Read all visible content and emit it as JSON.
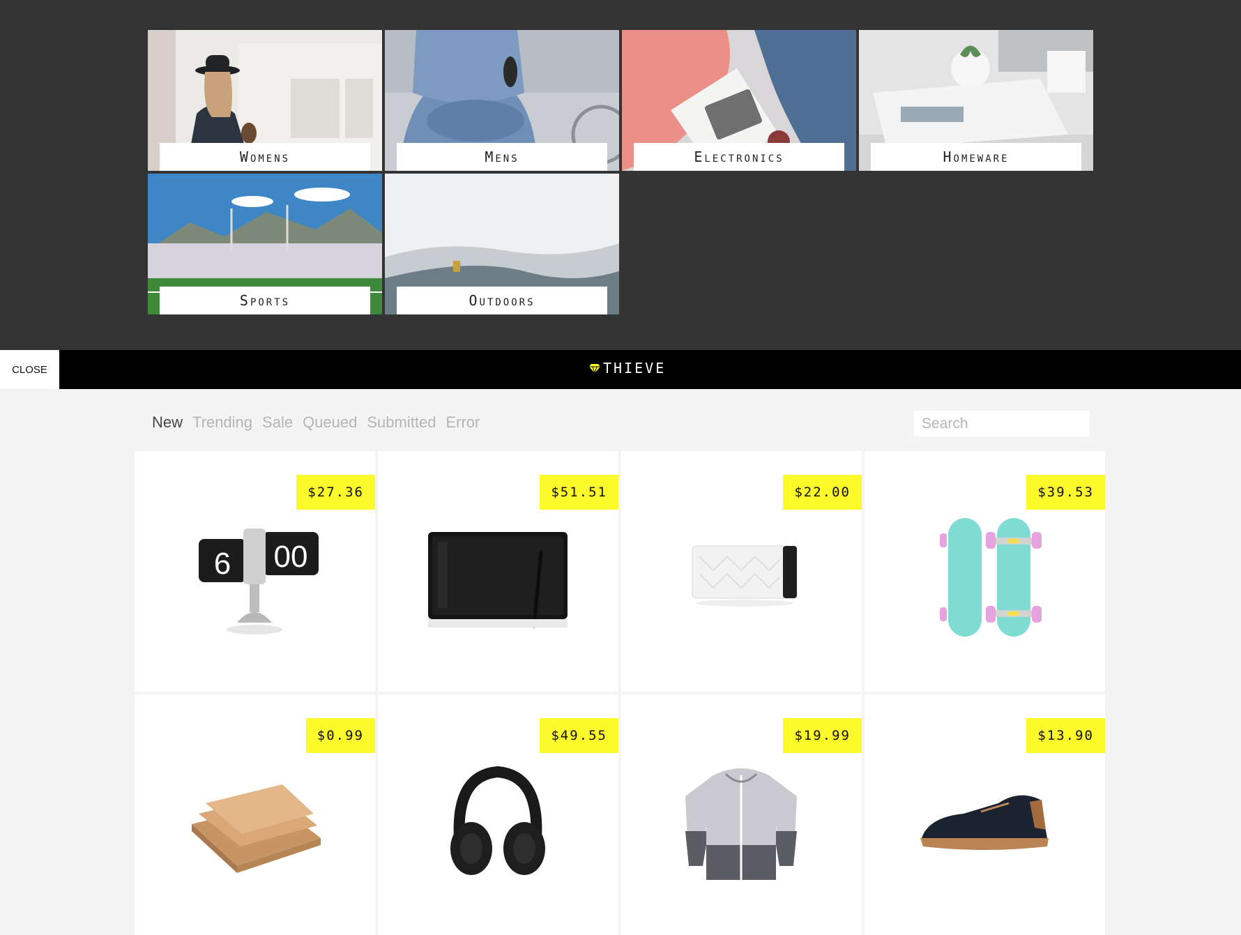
{
  "categories": [
    {
      "label": "Womens"
    },
    {
      "label": "Mens"
    },
    {
      "label": "Electronics"
    },
    {
      "label": "Homeware"
    },
    {
      "label": "Sports"
    },
    {
      "label": "Outdoors"
    }
  ],
  "topbar": {
    "close_label": "CLOSE",
    "brand": "THIEVE",
    "brand_icon": "diamond-icon",
    "accent_color": "#fdfa2c"
  },
  "filters": {
    "tabs": [
      {
        "label": "New",
        "active": true
      },
      {
        "label": "Trending"
      },
      {
        "label": "Sale"
      },
      {
        "label": "Queued"
      },
      {
        "label": "Submitted"
      },
      {
        "label": "Error"
      }
    ],
    "search_placeholder": "Search"
  },
  "products": [
    {
      "price": "$27.36",
      "item": "flip clock"
    },
    {
      "price": "$51.51",
      "item": "drawing tablet"
    },
    {
      "price": "$22.00",
      "item": "bluetooth speaker"
    },
    {
      "price": "$39.53",
      "item": "penny board"
    },
    {
      "price": "$0.99",
      "item": "kraft notebooks"
    },
    {
      "price": "$49.55",
      "item": "headphones"
    },
    {
      "price": "$19.99",
      "item": "windbreaker jacket"
    },
    {
      "price": "$13.90",
      "item": "suede shoe"
    }
  ]
}
